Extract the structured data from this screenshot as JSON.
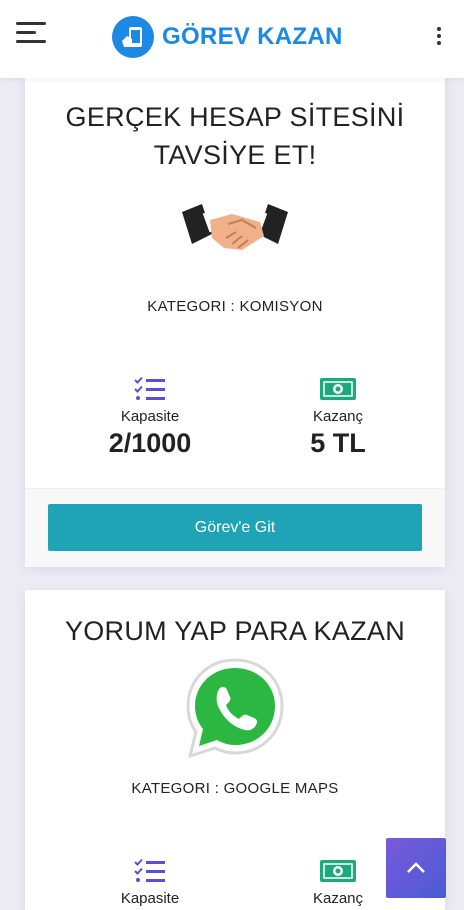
{
  "header": {
    "brand_name": "GÖREV KAZAN",
    "menu_icon": "hamburger-menu-icon",
    "options_icon": "vertical-dots-icon",
    "accent_color": "#1e88e5"
  },
  "tasks": [
    {
      "title_line1": "GERÇEK HESAP SİTESİNİ",
      "title_line2": "TAVSİYE ET!",
      "image": "handshake-icon",
      "category": "KATEGORI : KOMISYON",
      "capacity_label": "Kapasite",
      "capacity_value": "2/1000",
      "earning_label": "Kazanç",
      "earning_value": "5 TL",
      "button_label": "Görev'e Git"
    },
    {
      "title_line1": "YORUM YAP PARA KAZAN",
      "image": "whatsapp-icon",
      "category": "KATEGORI : GOOGLE MAPS",
      "capacity_label": "Kapasite",
      "earning_label": "Kazanç"
    }
  ],
  "colors": {
    "button": "#1fa3b6",
    "stat_icon_purple": "#5b4fd6",
    "stat_icon_green": "#1ea97c",
    "scroll_top": "#6a5ad8"
  },
  "scroll_top_icon": "chevron-up-icon"
}
